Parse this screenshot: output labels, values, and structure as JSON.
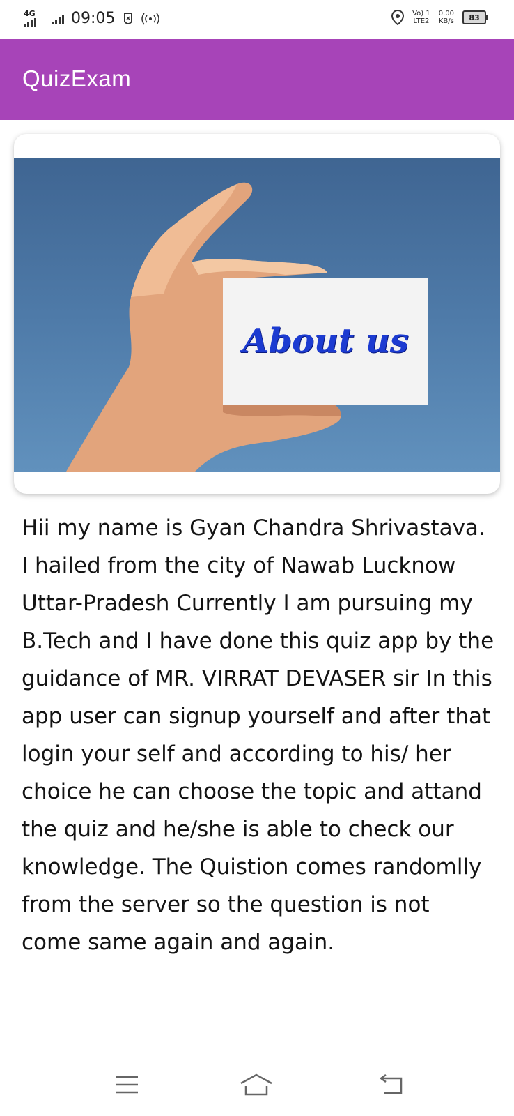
{
  "status_bar": {
    "network_type": "4G",
    "time": "09:05",
    "volte_top": "Vo) 1",
    "volte_bottom": "LTE2",
    "speed_value": "0.00",
    "speed_unit": "KB/s",
    "battery": "83"
  },
  "app_bar": {
    "title": "QuizExam"
  },
  "banner": {
    "sign_text": "About us"
  },
  "about": {
    "text": "Hii my name is Gyan Chandra Shrivastava. I hailed from the city of Nawab Lucknow Uttar-Pradesh Currently I am pursuing my B.Tech and I have done this quiz app by the guidance of MR. VIRRAT DEVASER sir In this app user can signup yourself and after that login your self and according to his/ her choice he can choose the topic and attand the quiz and he/she is able to check our knowledge. The Quistion comes randomlly from the server so the question is not come same again and again."
  },
  "colors": {
    "app_bar": "#a744b8",
    "sign_text": "#1c3bd1"
  },
  "nav_icons": [
    "menu-icon",
    "home-icon",
    "back-icon"
  ]
}
